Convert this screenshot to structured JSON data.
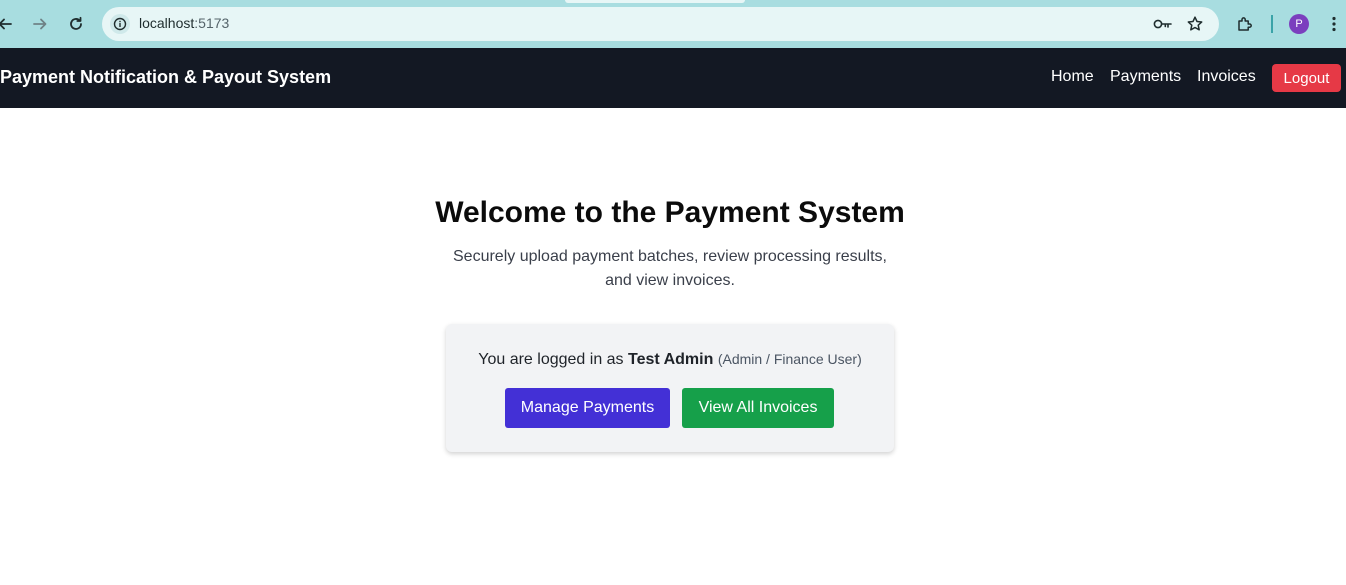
{
  "browser": {
    "url_host": "localhost",
    "url_port": ":5173",
    "avatar_letter": "P",
    "icons": [
      "back-arrow-icon",
      "forward-arrow-icon",
      "reload-icon",
      "info-icon",
      "key-icon",
      "star-icon",
      "puzzle-icon",
      "kebab-menu-icon"
    ]
  },
  "navbar": {
    "brand": "Payment Notification & Payout System",
    "links": [
      "Home",
      "Payments",
      "Invoices"
    ],
    "logout_label": "Logout"
  },
  "hero": {
    "title": "Welcome to the Payment System",
    "subtitle": "Securely upload payment batches, review processing results, and view invoices."
  },
  "session": {
    "prefix": "You are logged in as",
    "user_name": "Test Admin",
    "role": "(Admin / Finance User)"
  },
  "actions": {
    "manage_payments_label": "Manage Payments",
    "view_invoices_label": "View All Invoices"
  },
  "colors": {
    "navbar_bg": "#131823",
    "logout_bg": "#e63946",
    "primary_button": "#4330d6",
    "success_button": "#16a04a",
    "browser_frame": "#a8dde0"
  }
}
